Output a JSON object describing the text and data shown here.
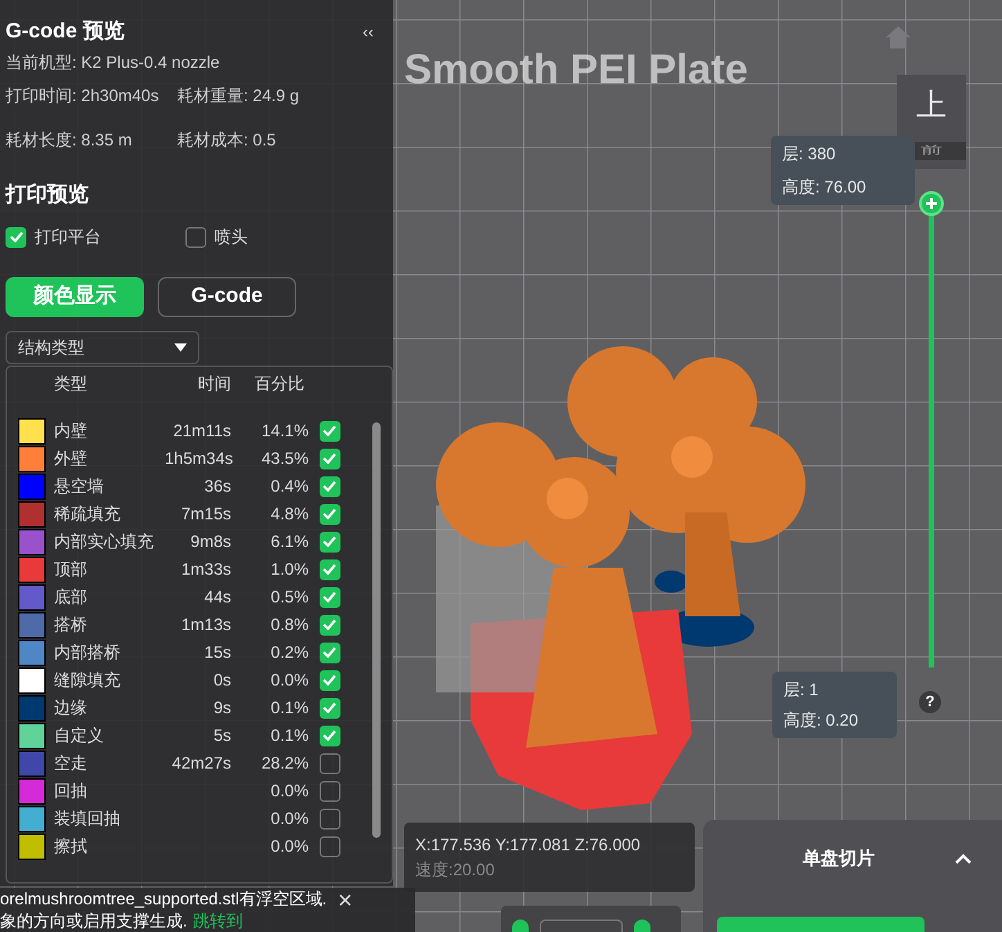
{
  "plate_label": "Smooth PEI Plate",
  "panel": {
    "title": "G-code 预览",
    "collapse": "‹‹",
    "machine": "当前机型: K2 Plus-0.4 nozzle",
    "stats": [
      "打印时间: 2h30m40s",
      "耗材重量: 24.9 g",
      "耗材长度: 8.35 m",
      "耗材成本: 0.5"
    ],
    "section_title": "打印预览",
    "options": [
      {
        "label": "打印平台",
        "checked": true
      },
      {
        "label": "喷头",
        "checked": false
      }
    ],
    "view_buttons": [
      {
        "label": "颜色显示",
        "selected": true
      },
      {
        "label": "G-code",
        "selected": false
      }
    ],
    "dropdown": {
      "value": "结构类型"
    },
    "legend": {
      "columns": [
        "类型",
        "时间",
        "百分比"
      ],
      "rows": [
        {
          "color": "#ffe14d",
          "name": "内壁",
          "time": "21m11s",
          "percent": "14.1%",
          "checked": true
        },
        {
          "color": "#ff7f3a",
          "name": "外壁",
          "time": "1h5m34s",
          "percent": "43.5%",
          "checked": true
        },
        {
          "color": "#0000ff",
          "name": "悬空墙",
          "time": "36s",
          "percent": "0.4%",
          "checked": true
        },
        {
          "color": "#b02f2f",
          "name": "稀疏填充",
          "time": "7m15s",
          "percent": "4.8%",
          "checked": true
        },
        {
          "color": "#9a52cc",
          "name": "内部实心填充",
          "time": "9m8s",
          "percent": "6.1%",
          "checked": true
        },
        {
          "color": "#e83a3a",
          "name": "顶部",
          "time": "1m33s",
          "percent": "1.0%",
          "checked": true
        },
        {
          "color": "#6459c9",
          "name": "底部",
          "time": "44s",
          "percent": "0.5%",
          "checked": true
        },
        {
          "color": "#4f6aa8",
          "name": "搭桥",
          "time": "1m13s",
          "percent": "0.8%",
          "checked": true
        },
        {
          "color": "#4f86c6",
          "name": "内部搭桥",
          "time": "15s",
          "percent": "0.2%",
          "checked": true
        },
        {
          "color": "#ffffff",
          "name": "缝隙填充",
          "time": "0s",
          "percent": "0.0%",
          "checked": true
        },
        {
          "color": "#003870",
          "name": "边缘",
          "time": "9s",
          "percent": "0.1%",
          "checked": true
        },
        {
          "color": "#5fd39a",
          "name": "自定义",
          "time": "5s",
          "percent": "0.1%",
          "checked": true
        },
        {
          "color": "#3f48a8",
          "name": "空走",
          "time": "42m27s",
          "percent": "28.2%",
          "checked": false
        },
        {
          "color": "#d42ad8",
          "name": "回抽",
          "percent": "0.0%",
          "checked": false
        },
        {
          "color": "#44aed0",
          "name": "装填回抽",
          "percent": "0.0%",
          "checked": false
        },
        {
          "color": "#bfbf00",
          "name": "擦拭",
          "percent": "0.0%",
          "checked": false
        }
      ]
    }
  },
  "cursor_info": {
    "coordinates": "X:177.536  Y:177.081  Z:76.000",
    "speed": "速度:20.00"
  },
  "notification": {
    "lines": [
      "orelmushroomtree_supported.stl有浮空区域.",
      "象的方向或启用支撑生成."
    ],
    "link": "跳转到",
    "close": "×"
  },
  "view_cube": {
    "top": "上",
    "front": "前"
  },
  "layer_slider": {
    "level": 1,
    "upper": {
      "layer": "层: 380",
      "height": "高度: 76.00"
    },
    "lower": {
      "layer": "层: 1",
      "height": "高度: 0.20"
    },
    "help": "?"
  },
  "slice_panel": {
    "label": "单盘切片"
  }
}
